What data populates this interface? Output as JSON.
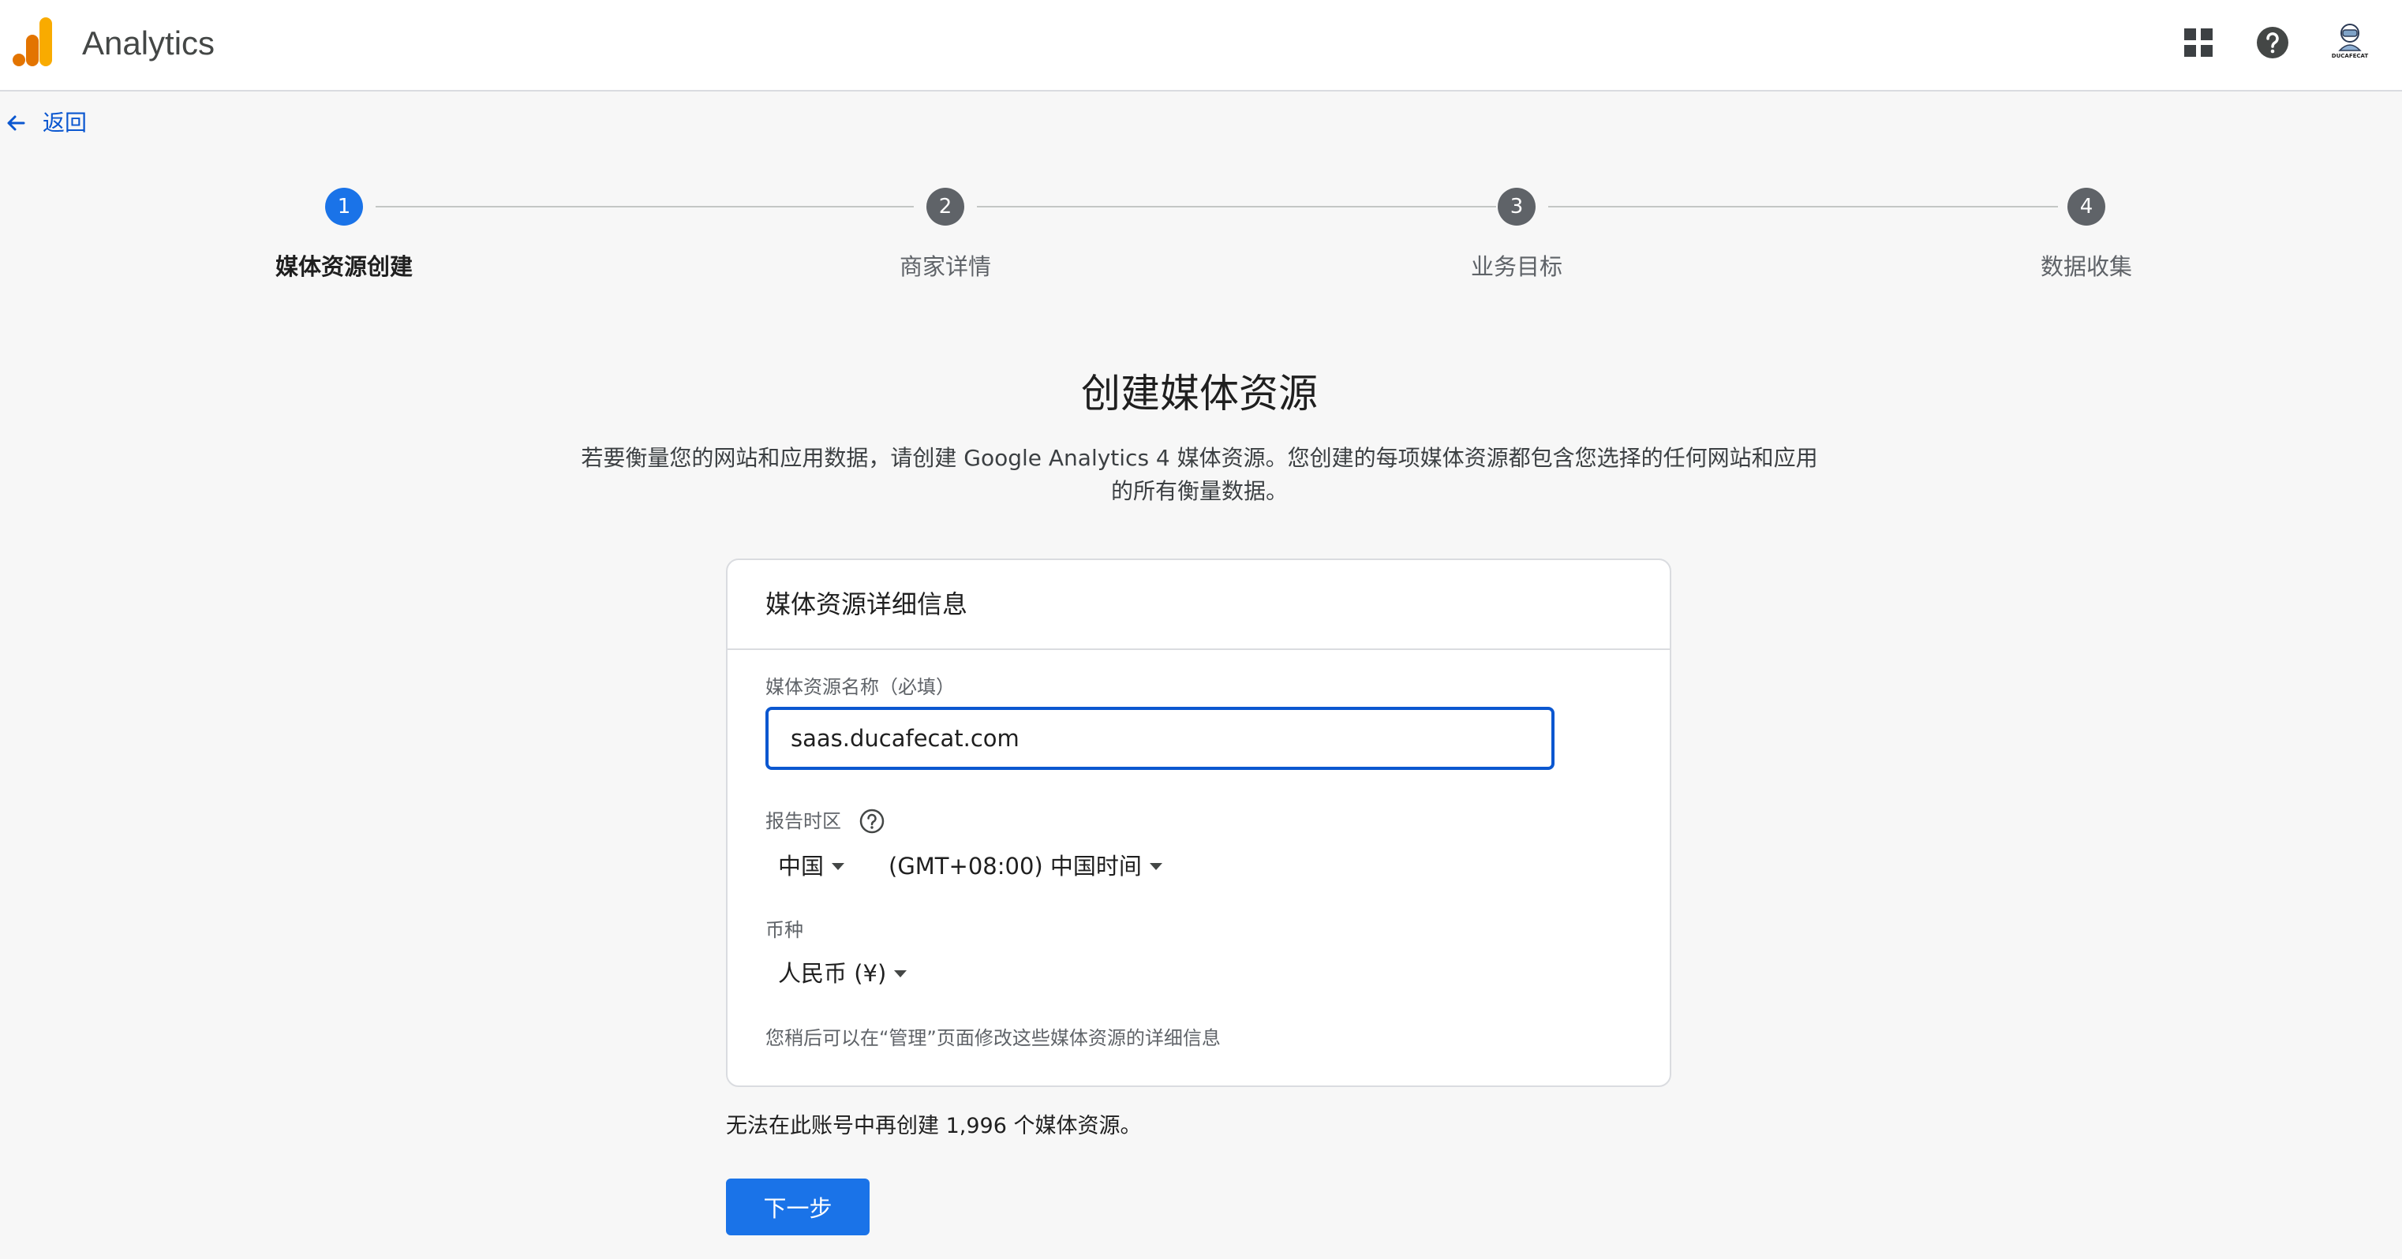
{
  "header": {
    "app_title": "Analytics",
    "logo_icon": "analytics-bars-logo",
    "icons": [
      "apps-grid-icon",
      "help-circle-icon"
    ],
    "avatar_label": "DUCAFECAT"
  },
  "back": {
    "label": "返回",
    "icon": "arrow-left-icon"
  },
  "stepper": {
    "steps": [
      {
        "number": "1",
        "label": "媒体资源创建",
        "active": true
      },
      {
        "number": "2",
        "label": "商家详情",
        "active": false
      },
      {
        "number": "3",
        "label": "业务目标",
        "active": false
      },
      {
        "number": "4",
        "label": "数据收集",
        "active": false
      }
    ],
    "active_color": "#1a73e8",
    "inactive_color": "#5f6368"
  },
  "intro": {
    "title": "创建媒体资源",
    "description_line1": "若要衡量您的网站和应用数据，请创建 Google Analytics 4 媒体资源。您创建的每项媒体资源都包含您选择的任何网站和应用",
    "description_line2": "的所有衡量数据。"
  },
  "card": {
    "title": "媒体资源详细信息",
    "property_name": {
      "label": "媒体资源名称（必填）",
      "value": "saas.ducafecat.com"
    },
    "timezone": {
      "label": "报告时区",
      "help_icon": "help-circle-outline-icon",
      "country": "中国",
      "zone": "(GMT+08:00) 中国时间"
    },
    "currency": {
      "label": "币种",
      "value": "人民币 (¥)"
    },
    "note": "您稍后可以在“管理”页面修改这些媒体资源的详细信息"
  },
  "limit_text": "无法在此账号中再创建 1,996 个媒体资源。",
  "next_button": "下一步",
  "colors": {
    "primary": "#1a73e8",
    "focus_border": "#0b57d0",
    "background": "#f7f7f7"
  }
}
